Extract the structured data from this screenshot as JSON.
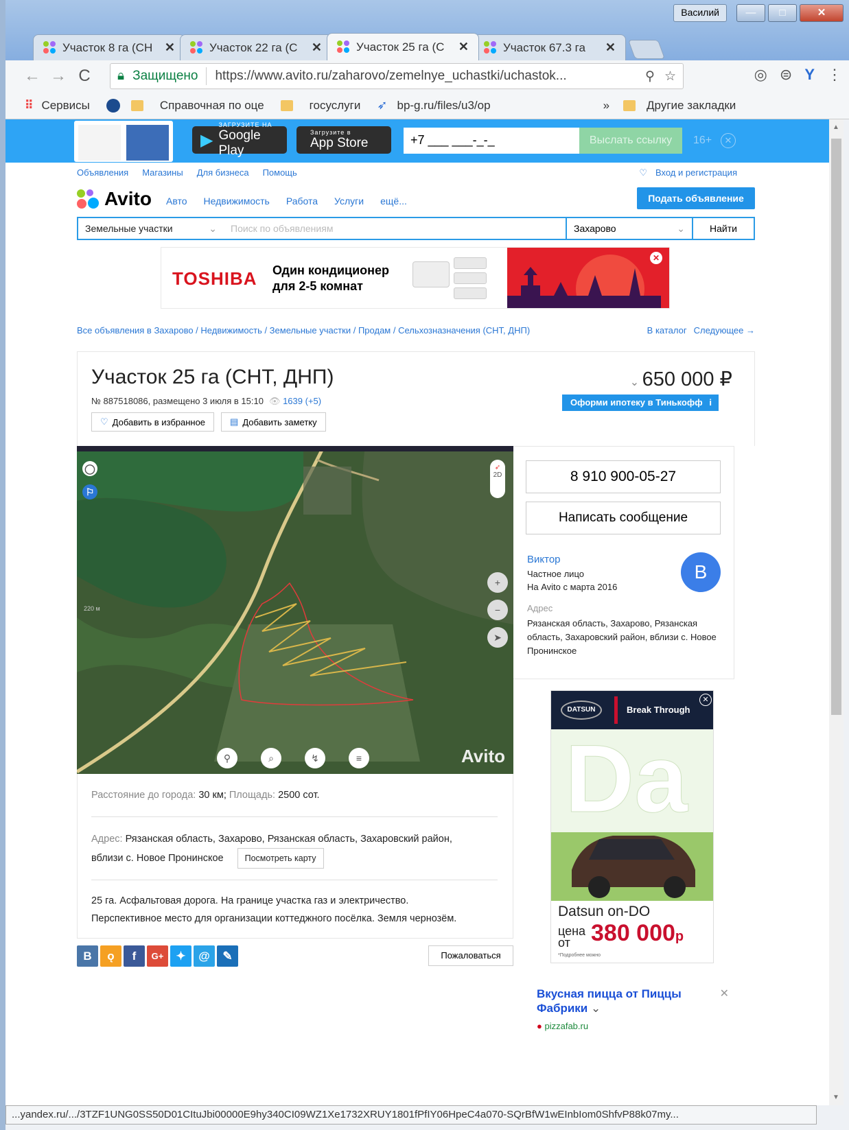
{
  "window": {
    "user": "Василий",
    "min": "—",
    "max": "□",
    "close": "✕"
  },
  "tabs": [
    {
      "title": "Участок 8 га (СН",
      "close": "✕"
    },
    {
      "title": "Участок 22 га (С",
      "close": "✕"
    },
    {
      "title": "Участок 25 га (С",
      "close": "✕"
    },
    {
      "title": "Участок 67.3 га",
      "close": "✕"
    }
  ],
  "omnibox": {
    "secure": "Защищено",
    "url": "https://www.avito.ru/zaharovo/zemelnye_uchastki/uchastok..."
  },
  "bookmarks": {
    "apps": "Сервисы",
    "items": [
      "Справочная по оце",
      "госуслуги",
      "bp-g.ru/files/u3/op"
    ],
    "more": "»",
    "other": "Другие закладки"
  },
  "appbar": {
    "gp_small": "ЗАГРУЗИТЕ НА",
    "gp": "Google Play",
    "as_small": "Загрузите в",
    "as": "App Store",
    "phone_ph": "+7 ___ ___-_-_",
    "send": "Выслать ссылку",
    "age": "16+",
    "close": "✕"
  },
  "toplinks": {
    "items": [
      "Объявления",
      "Магазины",
      "Для бизнеса",
      "Помощь"
    ],
    "login": "Вход и регистрация"
  },
  "header": {
    "logo": "Avito",
    "nav": [
      "Авто",
      "Недвижимость",
      "Работа",
      "Услуги",
      "ещё..."
    ],
    "post": "Подать объявление"
  },
  "search": {
    "category": "Земельные участки",
    "placeholder": "Поиск по объявлениям",
    "location": "Захарово",
    "button": "Найти"
  },
  "banner": {
    "brand": "TOSHIBA",
    "line1": "Один кондиционер",
    "line2": "для 2-5 комнат",
    "close": "✕"
  },
  "breadcrumbs": {
    "path": "Все объявления в Захарово / Недвижимость / Земельные участки / Продам / Сельхозназначения (СНТ, ДНП)",
    "catalog": "В каталог",
    "next": "Следующее →"
  },
  "listing": {
    "title": "Участок 25 га (СНТ, ДНП)",
    "meta": "№ 887518086, размещено 3 июля в 15:10",
    "views": "1639 (+5)",
    "fav": "Добавить в избранное",
    "note": "Добавить заметку",
    "price": "650 000 ₽",
    "mortgage": "Оформи ипотеку в Тинькофф",
    "mortgage_info": "i"
  },
  "map": {
    "watermark": "Avito",
    "zoom_in": "+",
    "zoom_out": "−",
    "scale": "220 м",
    "mode_2d": "2D"
  },
  "details": {
    "dist_label": "Расстояние до города:",
    "dist": "30 км;",
    "area_label": "Площадь:",
    "area": "2500 сот.",
    "addr_label": "Адрес:",
    "addr_line1": "Рязанская область, Захарово, Рязанская область, Захаровский район,",
    "addr_line2": "вблизи с. Новое Пронинское",
    "map_btn": "Посмотреть карту",
    "desc1": "25 га. Асфальтовая дорога. На границе участка газ и электричество.",
    "desc2": "Перспективное место для организации коттеджного посёлка. Земля чернозём."
  },
  "share": {
    "complain": "Пожаловаться"
  },
  "seller": {
    "phone": "8 910 900-05-27",
    "message": "Написать сообщение",
    "name": "Виктор",
    "type": "Частное лицо",
    "since": "На Avito с марта 2016",
    "avatar": "В",
    "addr_label": "Адрес",
    "address": "Рязанская область, Захарово, Рязанская область, Захаровский район, вблизи с. Новое Пронинское"
  },
  "ad": {
    "brand": "DATSUN",
    "slogan": "Break Through",
    "model": "Datsun on-DO",
    "price_label": "цена от",
    "price": "380 000",
    "currency": "р",
    "fine": "*Подробнее можно"
  },
  "pizza": {
    "title": "Вкусная пицца от Пиццы Фабрики",
    "site": "pizzafab.ru",
    "close": "✕"
  },
  "status": {
    "url": "...yandex.ru/.../3TZF1UNG0SS50D01CItuJbi00000E9hy340CI09WZ1Xe1732XRUY1801fPfIY06HpeC4a070-SQrBfW1wEInbIom0ShfvP88k07my..."
  }
}
